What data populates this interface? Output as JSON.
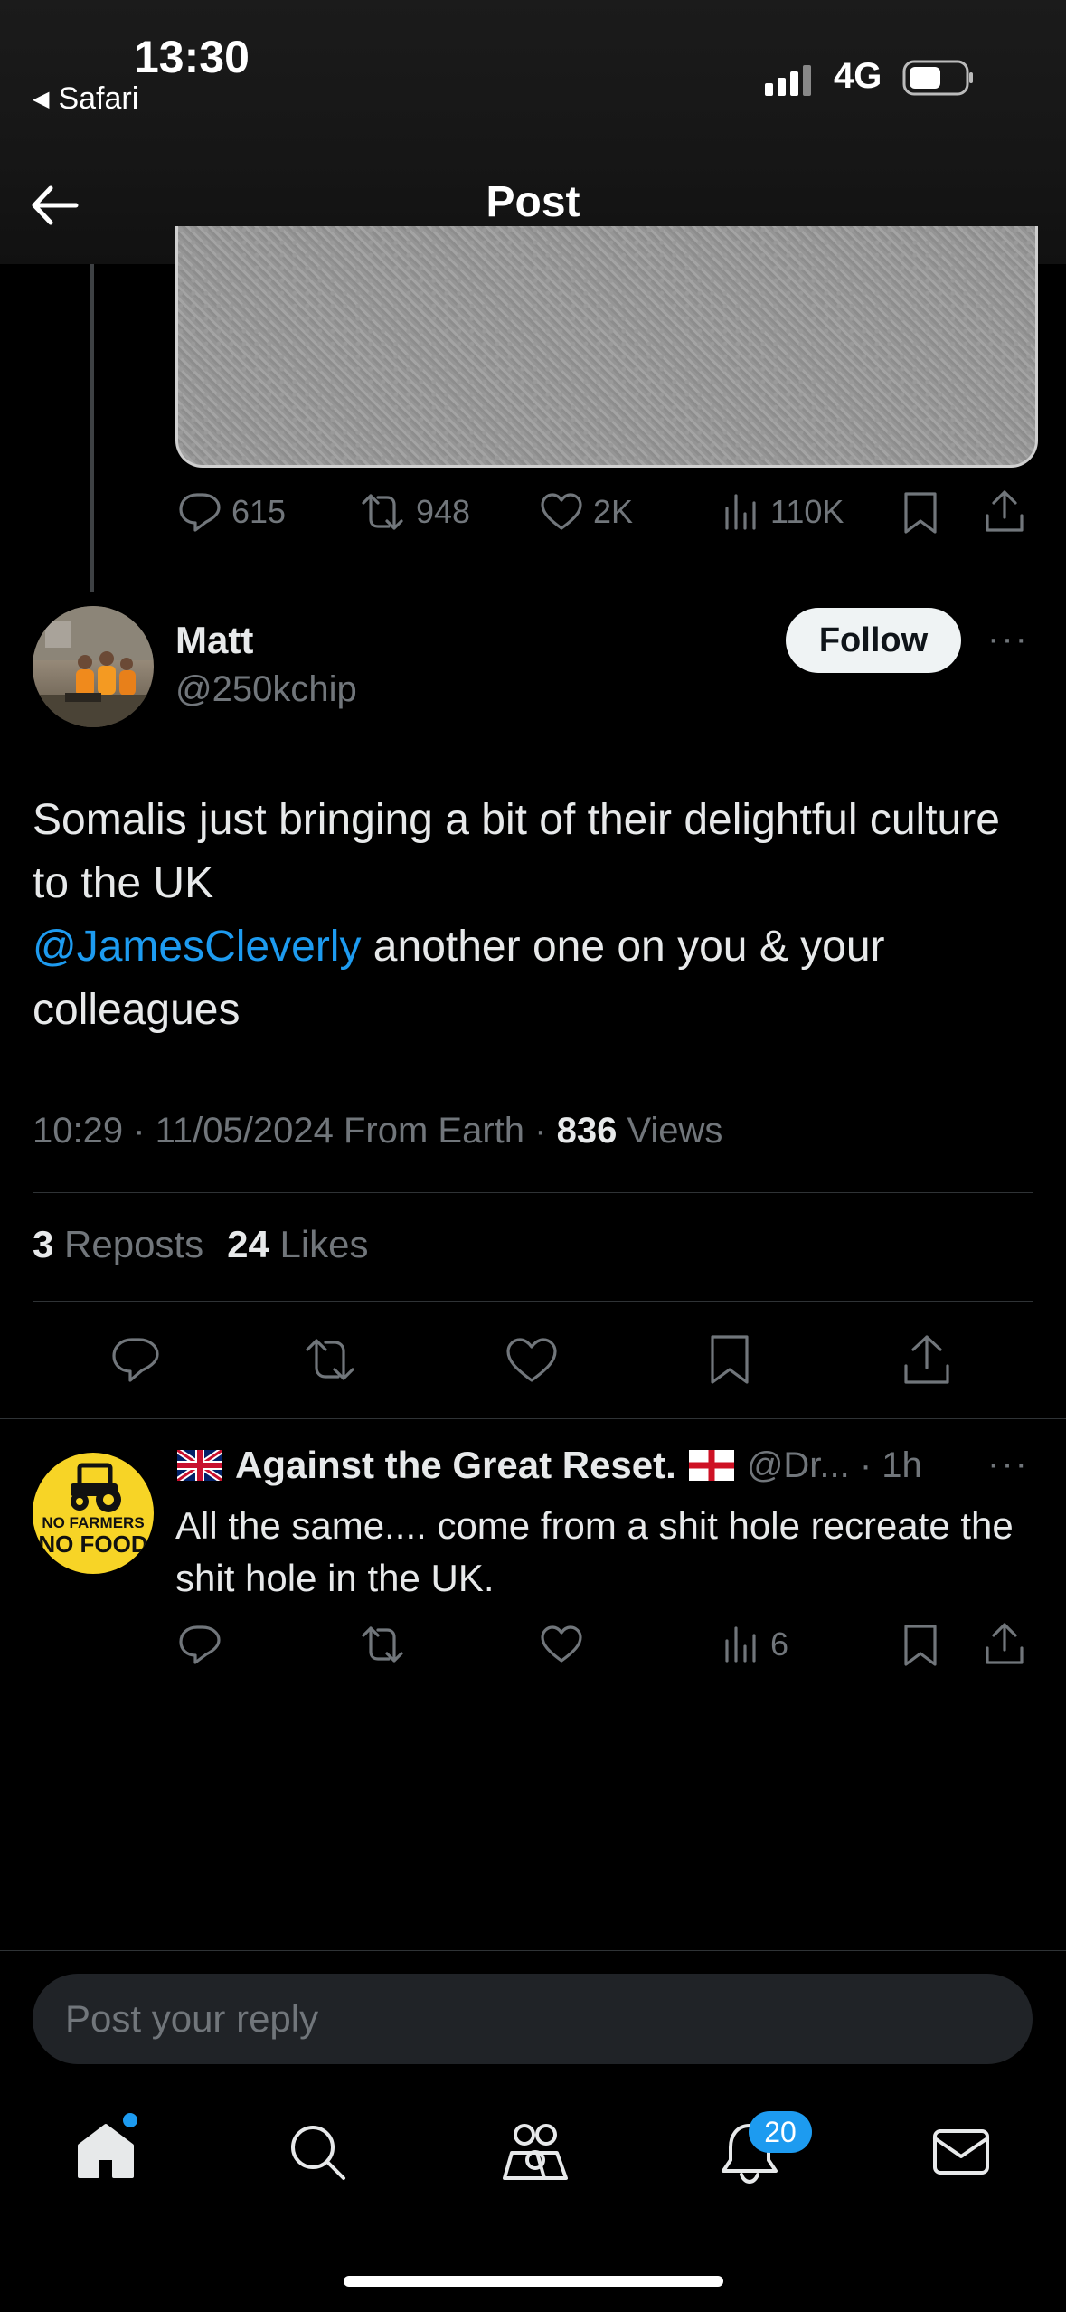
{
  "status_bar": {
    "time": "13:30",
    "back_app": "Safari",
    "network": "4G"
  },
  "header": {
    "title": "Post"
  },
  "prev_post": {
    "stats": {
      "replies": "615",
      "reposts": "948",
      "likes": "2K",
      "views": "110K"
    }
  },
  "post": {
    "author_name": "Matt",
    "author_handle": "@250kchip",
    "follow_label": "Follow",
    "more_label": "···",
    "text_line1": "Somalis just bringing a bit of their delightful culture to the UK",
    "mention": "@JamesCleverly",
    "text_line2": " another one on you & your colleagues",
    "time": "10:29 · 11/05/2024 From Earth · ",
    "views_count": "836",
    "views_label": " Views",
    "reposts_count": "3",
    "reposts_label": " Reposts",
    "likes_count": "24",
    "likes_label": " Likes"
  },
  "reply": {
    "flag_left": "🇬🇧",
    "author_name": "Against the Great Reset.",
    "flag_right": "🏴",
    "handle_time": "@Dr... · 1h",
    "more_label": "···",
    "text": "All the same.... come from a shit hole recreate the shit hole in the UK.",
    "avatar_text_1": "NO FARMERS",
    "avatar_text_2": "NO FOOD",
    "views": "6"
  },
  "composer": {
    "placeholder": "Post your reply"
  },
  "tabbar": {
    "notifications_badge": "20"
  },
  "colors": {
    "accent": "#1d9bf0",
    "background": "#000000",
    "muted": "#71767b"
  }
}
